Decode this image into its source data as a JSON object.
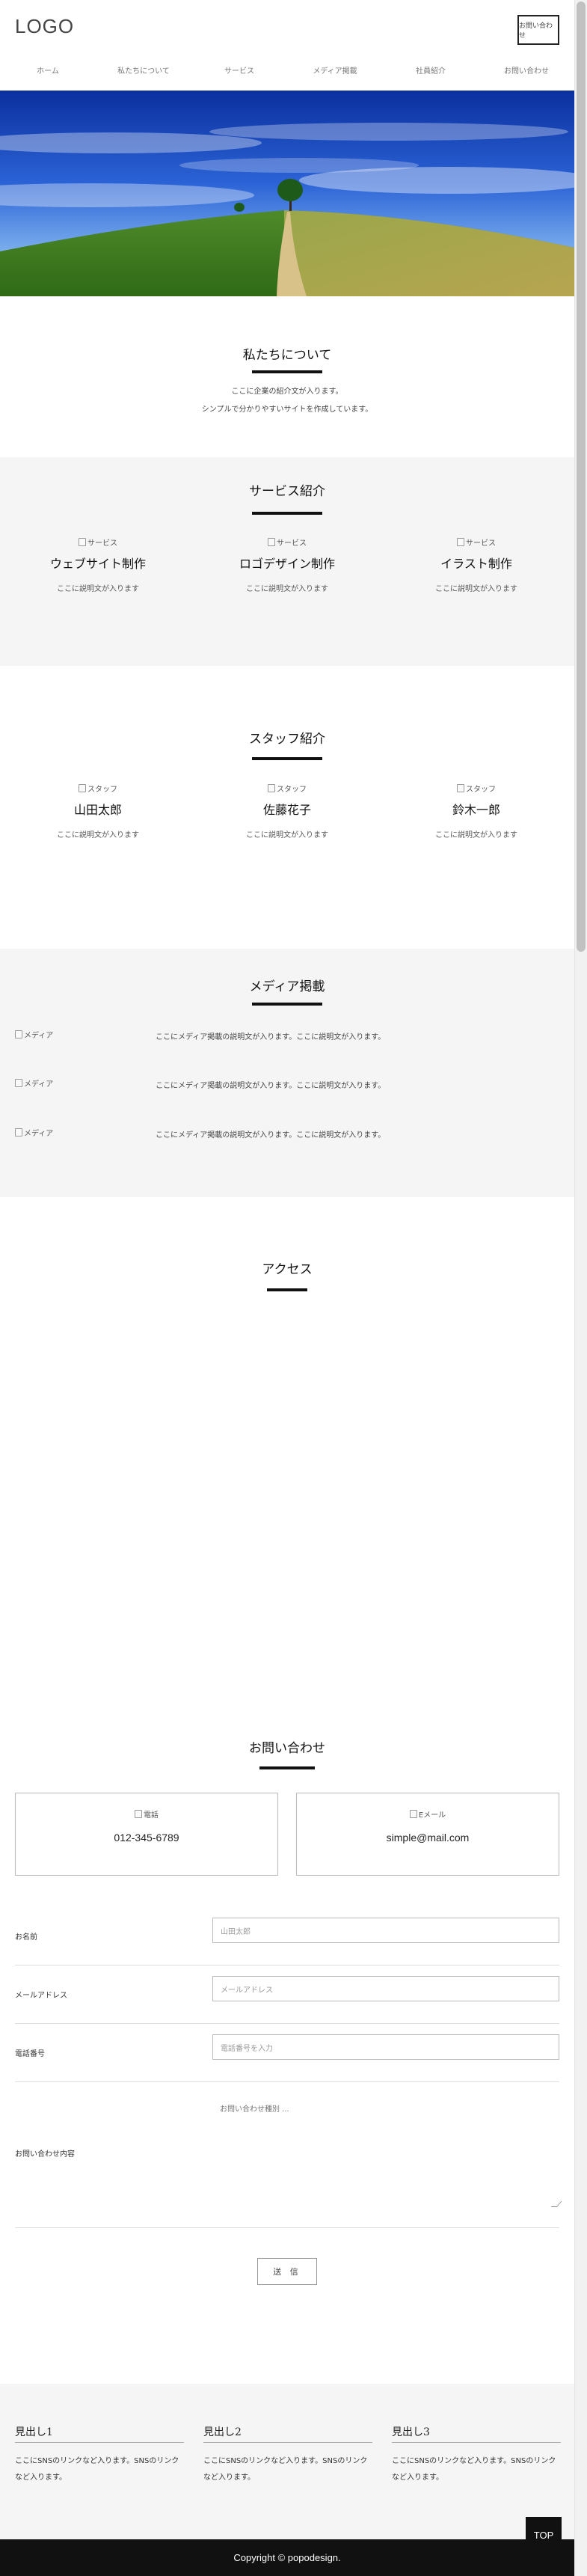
{
  "header": {
    "logo": "LOGO",
    "cta": "お問い合わせ",
    "nav": [
      "ホーム",
      "私たちについて",
      "サービス",
      "メディア掲載",
      "社員紹介",
      "お問い合わせ"
    ]
  },
  "about": {
    "title": "私たちについて",
    "lines": [
      "ここに企業の紹介文が入ります。",
      "シンプルで分かりやすいサイトを作成しています。"
    ]
  },
  "services": {
    "title": "サービス紹介",
    "items": [
      {
        "img_alt": "サービス",
        "heading": "ウェブサイト制作",
        "text": "ここに説明文が入ります"
      },
      {
        "img_alt": "サービス",
        "heading": "ロゴデザイン制作",
        "text": "ここに説明文が入ります"
      },
      {
        "img_alt": "サービス",
        "heading": "イラスト制作",
        "text": "ここに説明文が入ります"
      }
    ]
  },
  "staff": {
    "title": "スタッフ紹介",
    "items": [
      {
        "img_alt": "スタッフ",
        "name": "山田太郎",
        "text": "ここに説明文が入ります"
      },
      {
        "img_alt": "スタッフ",
        "name": "佐藤花子",
        "text": "ここに説明文が入ります"
      },
      {
        "img_alt": "スタッフ",
        "name": "鈴木一郎",
        "text": "ここに説明文が入ります"
      }
    ]
  },
  "media": {
    "title": "メディア掲載",
    "items": [
      {
        "img_alt": "メディア",
        "text": "ここにメディア掲載の説明文が入ります。ここに説明文が入ります。"
      },
      {
        "img_alt": "メディア",
        "text": "ここにメディア掲載の説明文が入ります。ここに説明文が入ります。"
      },
      {
        "img_alt": "メディア",
        "text": "ここにメディア掲載の説明文が入ります。ここに説明文が入ります。"
      }
    ]
  },
  "access": {
    "title": "アクセス"
  },
  "contact": {
    "title": "お問い合わせ",
    "phone_alt": "電話",
    "phone": "012-345-6789",
    "email_alt": "Eメール",
    "email": "simple@mail.com",
    "form": {
      "name_label": "お名前",
      "name_placeholder": "山田太郎",
      "email_label": "メールアドレス",
      "email_placeholder": "メールアドレス",
      "phone_label": "電話番号",
      "phone_placeholder": "電話番号を入力",
      "select_text": "お問い合わせ種別 ...",
      "message_label": "お問い合わせ内容",
      "submit": "送 信"
    }
  },
  "footer": {
    "cols": [
      {
        "title": "見出し1",
        "text": "ここにSNSのリンクなど入ります。SNSのリンクなど入ります。"
      },
      {
        "title": "見出し2",
        "text": "ここにSNSのリンクなど入ります。SNSのリンクなど入ります。"
      },
      {
        "title": "見出し3",
        "text": "ここにSNSのリンクなど入ります。SNSのリンクなど入ります。"
      }
    ],
    "copyright": "Copyright © popodesign.",
    "top": "TOP"
  }
}
